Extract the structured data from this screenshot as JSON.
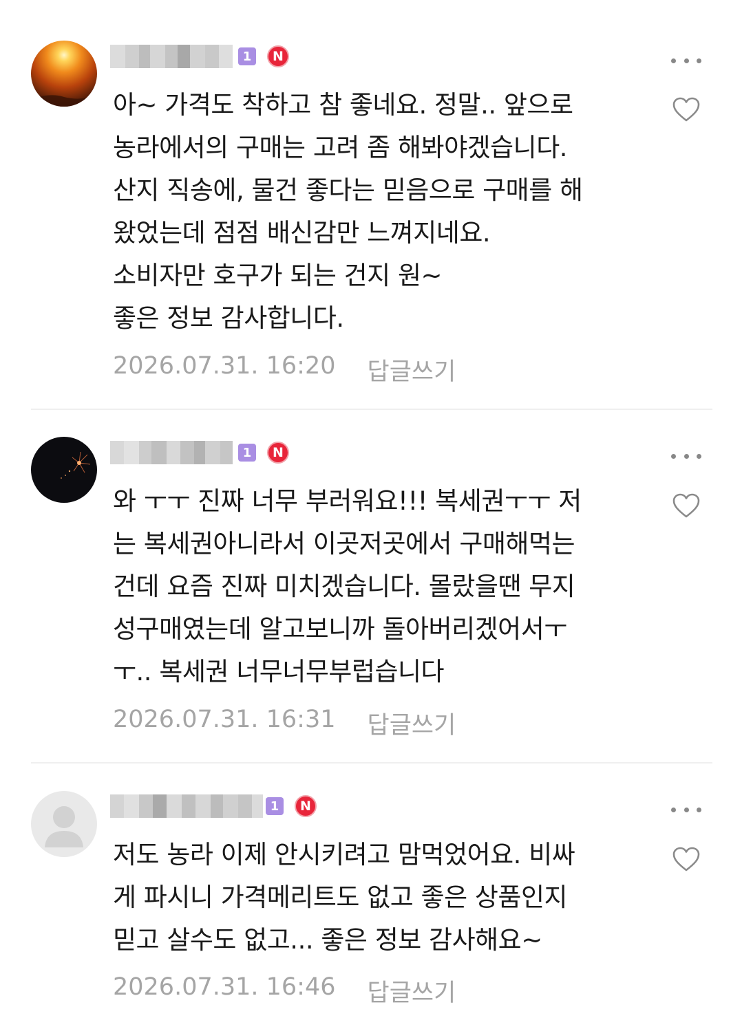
{
  "comments": [
    {
      "level_badge": "1",
      "new_badge": "N",
      "lines": [
        "아~ 가격도 착하고 참 좋네요. 정말.. 앞으로",
        "농라에서의 구매는 고려 좀 해봐야겠습니다.",
        "산지 직송에, 물건 좋다는 믿음으로 구매를 해",
        "왔었는데 점점 배신감만 느껴지네요.",
        "소비자만 호구가 되는 건지 원~",
        "좋은 정보 감사합니다."
      ],
      "timestamp": "2026.07.31. 16:20",
      "reply_label": "답글쓰기"
    },
    {
      "level_badge": "1",
      "new_badge": "N",
      "lines": [
        "와 ㅜㅜ 진짜 너무 부러워요!!! 복세권ㅜㅜ 저",
        "는 복세권아니라서 이곳저곳에서 구매해먹는",
        "건데 요즘 진짜 미치겠습니다. 몰랐을땐 무지",
        "성구매였는데 알고보니까 돌아버리겠어서ㅜ",
        "ㅜ.. 복세권 너무너무부럽습니다"
      ],
      "timestamp": "2026.07.31. 16:31",
      "reply_label": "답글쓰기"
    },
    {
      "level_badge": "1",
      "new_badge": "N",
      "lines": [
        "저도 농라 이제 안시키려고 맘먹었어요. 비싸",
        "게 파시니 가격메리트도 없고 좋은 상품인지",
        "믿고 살수도 없고... 좋은 정보 감사해요~"
      ],
      "timestamp": "2026.07.31. 16:46",
      "reply_label": "답글쓰기"
    }
  ],
  "icons": {
    "more": "more-dots-icon",
    "like": "heart-outline-icon",
    "avatar_default": "default-user-icon"
  },
  "colors": {
    "level_badge": "#a98ee3",
    "new_badge": "#e8253a",
    "meta_text": "#a5a5a5",
    "divider": "#efefef"
  }
}
